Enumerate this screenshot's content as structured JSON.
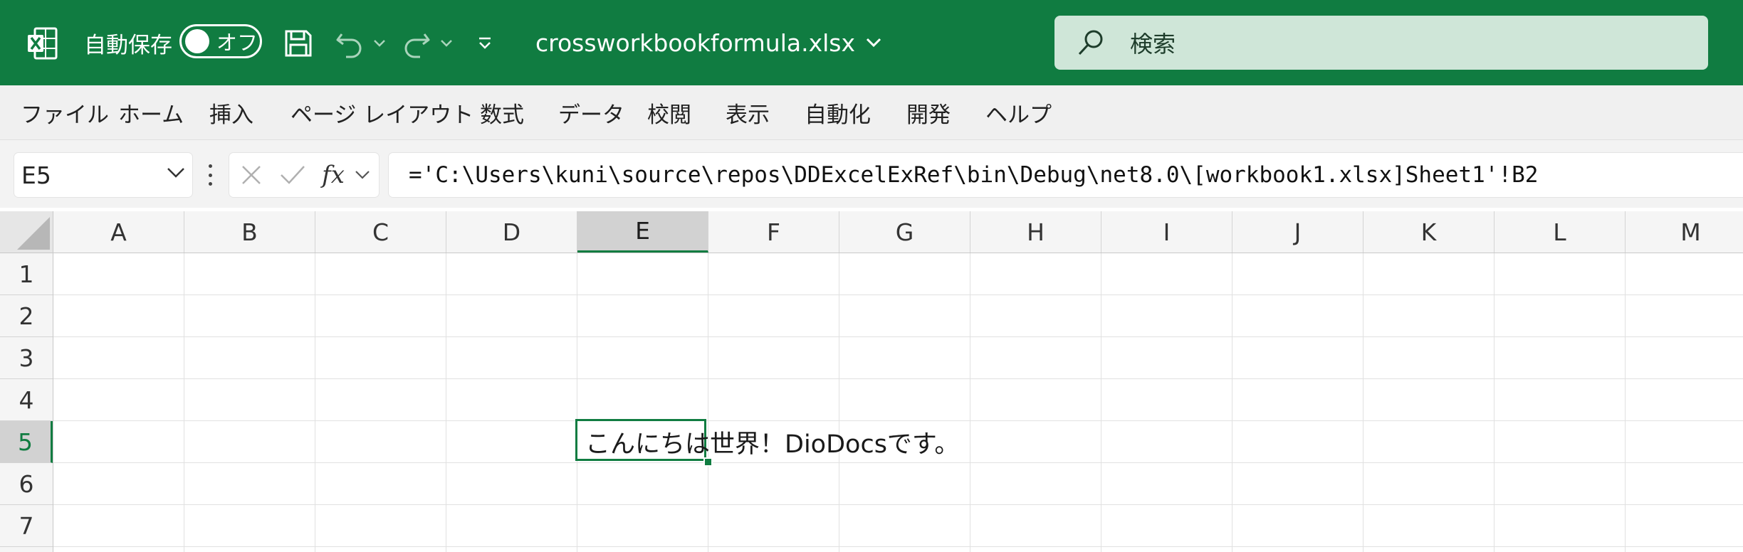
{
  "titlebar": {
    "autosave_label": "自動保存",
    "autosave_state": "オフ",
    "filename": "crossworkbookformula.xlsx",
    "search_placeholder": "検索",
    "colors": {
      "bar": "#107c41",
      "search_bg": "#cfe6d8"
    }
  },
  "ribbon": {
    "tabs": [
      "ファイル",
      "ホーム",
      "挿入",
      "ページ レイアウト",
      "数式",
      "データ",
      "校閲",
      "表示",
      "自動化",
      "開発",
      "ヘルプ"
    ]
  },
  "formula_bar": {
    "name_box": "E5",
    "fx_label": "fx",
    "formula": "='C:\\Users\\kuni\\source\\repos\\DDExcelExRef\\bin\\Debug\\net8.0\\[workbook1.xlsx]Sheet1'!B2"
  },
  "grid": {
    "columns": [
      "A",
      "B",
      "C",
      "D",
      "E",
      "F",
      "G",
      "H",
      "I",
      "J",
      "K",
      "L",
      "M"
    ],
    "rows": [
      "1",
      "2",
      "3",
      "4",
      "5",
      "6",
      "7"
    ],
    "selected_column": "E",
    "selected_row": "5",
    "cell_E5_text": "こんにちは世界！DioDocsです。",
    "accent_color": "#107c41"
  }
}
